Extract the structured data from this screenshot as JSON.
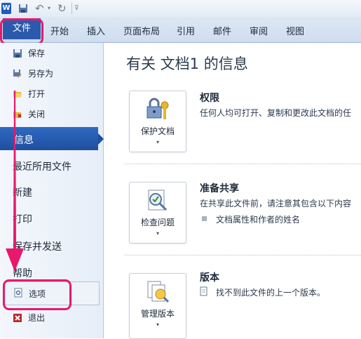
{
  "qat": {
    "app_icon_text": "W",
    "undo_symbol": "↶",
    "redo_symbol": "↻",
    "dropdown_symbol": "▾",
    "customize_symbol": "⊽"
  },
  "ribbon": {
    "file_tab": "文件",
    "tabs": [
      "开始",
      "插入",
      "页面布局",
      "引用",
      "邮件",
      "审阅",
      "视图"
    ]
  },
  "sidebar": {
    "save": "保存",
    "save_as": "另存为",
    "open": "打开",
    "close": "关闭",
    "info": "信息",
    "recent": "最近所用文件",
    "new": "新建",
    "print": "打印",
    "save_send": "保存并发送",
    "help": "帮助",
    "options": "选项",
    "exit": "退出"
  },
  "main": {
    "title": "有关 文档1 的信息",
    "permissions": {
      "button_label": "保护文档",
      "heading": "权限",
      "desc": "任何人均可打开、复制和更改此文档的任"
    },
    "prepare": {
      "button_label": "检查问题",
      "heading": "准备共享",
      "desc": "在共享此文件前，请注意其包含以下内容",
      "bullet": "文档属性和作者的姓名"
    },
    "versions": {
      "button_label": "管理版本",
      "heading": "版本",
      "desc": "找不到此文件的上一个版本。"
    },
    "dropdown_symbol": "▾"
  },
  "colors": {
    "file_tab_bg": "#2b5aad",
    "selected_item_bg": "#1f4f9e",
    "annotation_pink": "#e8186c"
  },
  "icons": [
    "word-icon",
    "save-icon",
    "undo-icon",
    "redo-icon",
    "lock-key-icon",
    "inspect-document-icon",
    "manage-versions-icon",
    "options-icon",
    "exit-icon",
    "open-folder-icon",
    "close-icon",
    "save-as-icon",
    "document-small-icon"
  ]
}
